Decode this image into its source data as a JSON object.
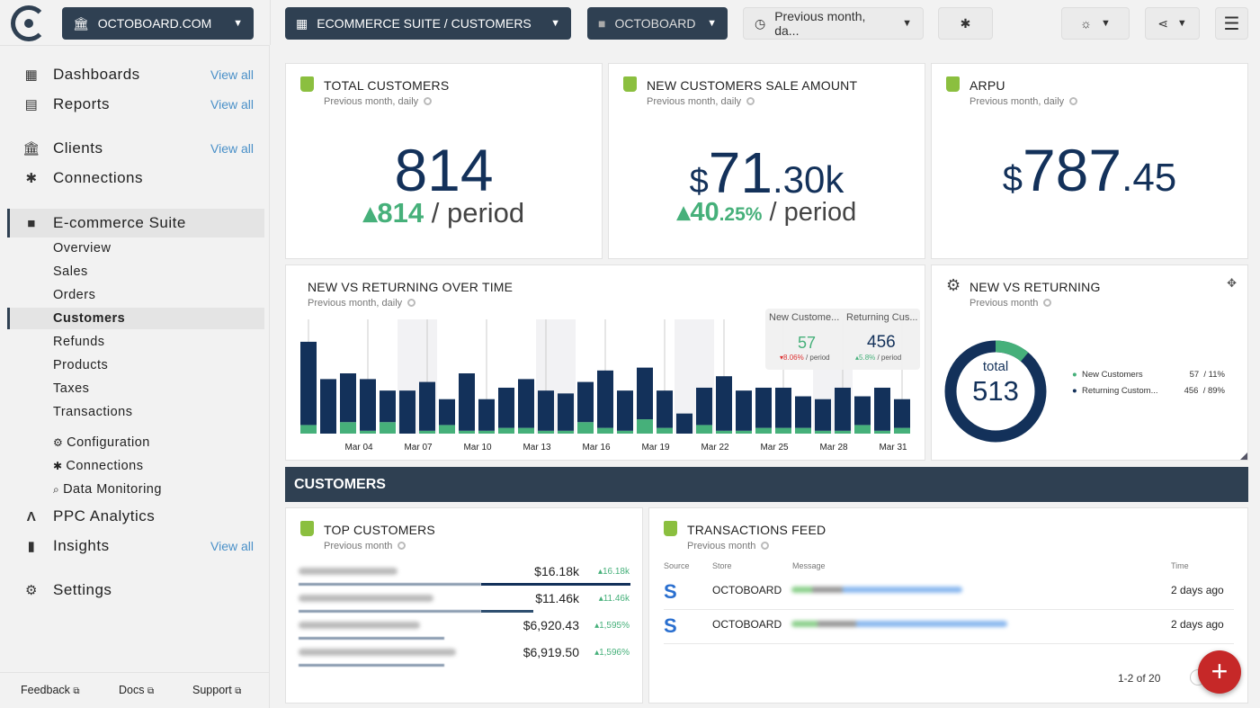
{
  "topbar": {
    "org": "OCTOBOARD.COM",
    "dashboard": "ECOMMERCE SUITE / CUSTOMERS",
    "store": "OCTOBOARD",
    "period": "Previous month, da..."
  },
  "sidebar": {
    "view_all": "View all",
    "items": [
      {
        "label": "Dashboards",
        "icon": "dashboard-icon"
      },
      {
        "label": "Reports",
        "icon": "clipboard-icon"
      },
      {
        "label": "Clients",
        "icon": "bank-icon"
      },
      {
        "label": "Connections",
        "icon": "plug-icon"
      },
      {
        "label": "E-commerce Suite",
        "icon": "shopping-bag-icon"
      },
      {
        "label": "PPC Analytics",
        "icon": "ppc-icon"
      },
      {
        "label": "Insights",
        "icon": "bar-chart-icon"
      },
      {
        "label": "Settings",
        "icon": "gear-icon"
      }
    ],
    "suite_items": [
      "Overview",
      "Sales",
      "Orders",
      "Customers",
      "Refunds",
      "Products",
      "Taxes",
      "Transactions"
    ],
    "suite_tools": [
      "Configuration",
      "Connections",
      "Data Monitoring"
    ],
    "footer": [
      "Feedback",
      "Docs",
      "Support"
    ]
  },
  "kpi": [
    {
      "title": "TOTAL CUSTOMERS",
      "sub": "Previous month, daily",
      "value": "814",
      "change": "814",
      "period": "/ period"
    },
    {
      "title": "NEW CUSTOMERS SALE AMOUNT",
      "sub": "Previous month, daily",
      "currency": "$",
      "value": "71",
      "decimals": ".30k",
      "change": "40",
      "change_dec": ".25%",
      "period": "/ period"
    },
    {
      "title": "ARPU",
      "sub": "Previous month, daily",
      "currency": "$",
      "value": "787",
      "decimals": ".45"
    }
  ],
  "timeline": {
    "title": "NEW VS RETURNING OVER TIME",
    "sub": "Previous month, daily",
    "tooltip": {
      "new_label": "New Custome...",
      "new_value": "57",
      "new_change": "▾8.06%",
      "returning_label": "Returning Cus...",
      "returning_value": "456",
      "returning_change": "▴5.8%",
      "period": "/ period"
    }
  },
  "donut": {
    "title": "NEW VS RETURNING",
    "sub": "Previous month",
    "total_label": "total",
    "total": "513",
    "legend": [
      {
        "label": "New Customers",
        "value": "57  / 11%",
        "color": "#46b07a"
      },
      {
        "label": "Returning Custom...",
        "value": "456  / 89%",
        "color": "#13315a"
      }
    ]
  },
  "section": "CUSTOMERS",
  "top_customers": {
    "title": "TOP CUSTOMERS",
    "sub": "Previous month",
    "rows": [
      {
        "amount": "$16.18k",
        "change": "▴16.18k",
        "share": 1
      },
      {
        "amount": "$11.46k",
        "change": "▴11.46k",
        "share": 0.708
      },
      {
        "amount": "$6,920.43",
        "change": "▴1,595%",
        "share": 0.428
      },
      {
        "amount": "$6,919.50",
        "change": "▴1,596%",
        "share": 0.428
      }
    ]
  },
  "feed": {
    "title": "TRANSACTIONS FEED",
    "sub": "Previous month",
    "columns": [
      "Source",
      "Store",
      "Message",
      "Time"
    ],
    "rows": [
      {
        "source": "S",
        "store": "OCTOBOARD",
        "time": "2 days ago"
      },
      {
        "source": "S",
        "store": "OCTOBOARD",
        "time": "2 days ago"
      }
    ],
    "pagination": "1-2 of 20"
  },
  "colors": {
    "navy": "#13315a",
    "green": "#46b07a",
    "header": "#2f4052",
    "fab": "#c62828"
  },
  "chart_data": {
    "type": "bar",
    "stacked": true,
    "categories": [
      "Mar 01",
      "Mar 02",
      "Mar 03",
      "Mar 04",
      "Mar 05",
      "Mar 06",
      "Mar 07",
      "Mar 08",
      "Mar 09",
      "Mar 10",
      "Mar 11",
      "Mar 12",
      "Mar 13",
      "Mar 14",
      "Mar 15",
      "Mar 16",
      "Mar 17",
      "Mar 18",
      "Mar 19",
      "Mar 20",
      "Mar 21",
      "Mar 22",
      "Mar 23",
      "Mar 24",
      "Mar 25",
      "Mar 26",
      "Mar 27",
      "Mar 28",
      "Mar 29",
      "Mar 30",
      "Mar 31"
    ],
    "tick_labels": [
      "Mar 04",
      "Mar 07",
      "Mar 10",
      "Mar 13",
      "Mar 16",
      "Mar 19",
      "Mar 22",
      "Mar 25",
      "Mar 28",
      "Mar 31"
    ],
    "series": [
      {
        "name": "New Customers",
        "color": "#46b07a",
        "values": [
          3,
          0,
          4,
          1,
          4,
          0,
          1,
          3,
          1,
          1,
          2,
          2,
          1,
          1,
          4,
          2,
          1,
          5,
          2,
          0,
          3,
          1,
          1,
          2,
          2,
          2,
          1,
          1,
          3,
          1,
          2
        ]
      },
      {
        "name": "Returning Customers",
        "color": "#13315a",
        "values": [
          29,
          19,
          17,
          18,
          11,
          15,
          17,
          9,
          20,
          11,
          14,
          17,
          14,
          13,
          14,
          20,
          14,
          18,
          13,
          7,
          13,
          19,
          14,
          14,
          14,
          11,
          11,
          15,
          10,
          15,
          10
        ]
      }
    ],
    "weekend_bands": [
      [
        "Mar 06",
        "Mar 07"
      ],
      [
        "Mar 13",
        "Mar 14"
      ],
      [
        "Mar 20",
        "Mar 21"
      ],
      [
        "Mar 27",
        "Mar 28"
      ]
    ]
  }
}
